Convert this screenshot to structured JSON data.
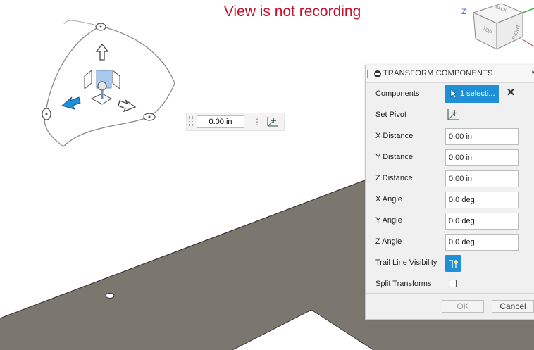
{
  "viewport": {
    "recording_status": "View is not recording",
    "viewcube": {
      "top": "TOP",
      "right": "RIGHT",
      "back": "BACK",
      "axis_z": "Z"
    },
    "distance_input": {
      "value": "0.00 in"
    }
  },
  "panel": {
    "title": "TRANSFORM COMPONENTS",
    "components": {
      "label": "Components",
      "selection": "1 selecti..."
    },
    "set_pivot": {
      "label": "Set Pivot"
    },
    "x_distance": {
      "label": "X Distance",
      "value": "0.00 in"
    },
    "y_distance": {
      "label": "Y Distance",
      "value": "0.00 in"
    },
    "z_distance": {
      "label": "Z Distance",
      "value": "0.00 in"
    },
    "x_angle": {
      "label": "X Angle",
      "value": "0.0 deg"
    },
    "y_angle": {
      "label": "Y Angle",
      "value": "0.0 deg"
    },
    "z_angle": {
      "label": "Z Angle",
      "value": "0.0 deg"
    },
    "trail_line": {
      "label": "Trail Line Visibility"
    },
    "split_transforms": {
      "label": "Split Transforms",
      "checked": false
    },
    "ok_label": "OK",
    "cancel_label": "Cancel"
  },
  "colors": {
    "recording_text": "#c8102e",
    "accent": "#1f8fd8",
    "body_surface": "#7b776e"
  },
  "icons": {
    "pivot": "pivot-icon",
    "cursor": "cursor-arrow-icon",
    "close": "close-icon",
    "trail": "trail-line-icon"
  }
}
